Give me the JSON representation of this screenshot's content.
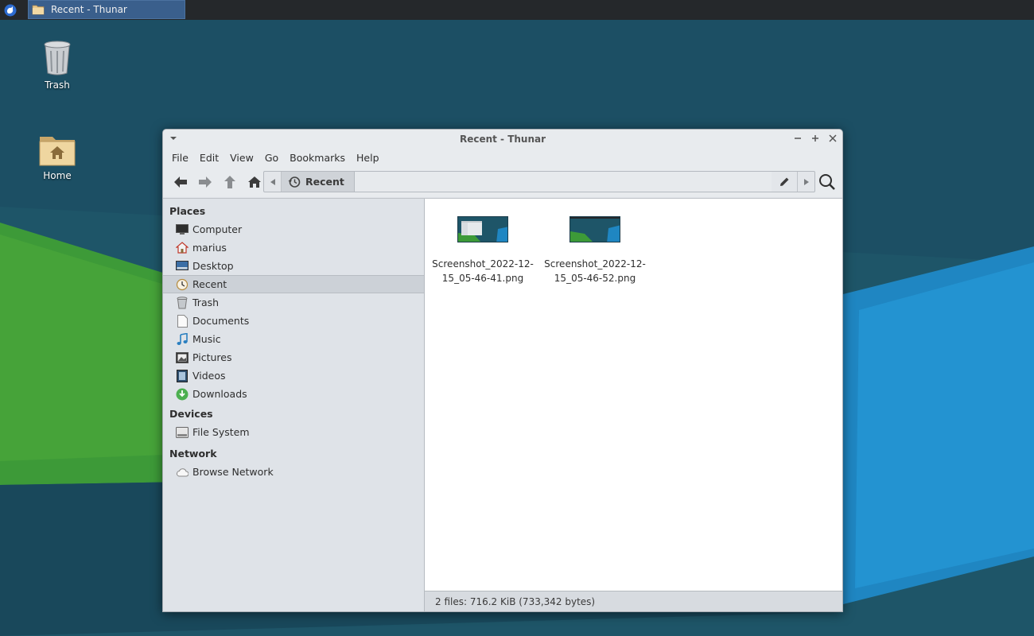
{
  "taskbar": {
    "window_button_label": "Recent - Thunar"
  },
  "desktop": {
    "icons": [
      {
        "label": "Trash"
      },
      {
        "label": "Home"
      }
    ]
  },
  "window": {
    "title": "Recent - Thunar",
    "menu": [
      "File",
      "Edit",
      "View",
      "Go",
      "Bookmarks",
      "Help"
    ],
    "path": {
      "current": "Recent"
    }
  },
  "sidebar": {
    "places_heading": "Places",
    "places": [
      {
        "label": "Computer",
        "icon": "computer-icon"
      },
      {
        "label": "marius",
        "icon": "home-icon"
      },
      {
        "label": "Desktop",
        "icon": "desktop-icon"
      },
      {
        "label": "Recent",
        "icon": "recent-icon",
        "active": true
      },
      {
        "label": "Trash",
        "icon": "trash-icon"
      },
      {
        "label": "Documents",
        "icon": "document-icon"
      },
      {
        "label": "Music",
        "icon": "music-icon"
      },
      {
        "label": "Pictures",
        "icon": "pictures-icon"
      },
      {
        "label": "Videos",
        "icon": "videos-icon"
      },
      {
        "label": "Downloads",
        "icon": "downloads-icon"
      }
    ],
    "devices_heading": "Devices",
    "devices": [
      {
        "label": "File System",
        "icon": "drive-icon"
      }
    ],
    "network_heading": "Network",
    "network": [
      {
        "label": "Browse Network",
        "icon": "network-icon"
      }
    ]
  },
  "files": [
    {
      "name": "Screenshot_2022-12-15_05-46-41.png"
    },
    {
      "name": "Screenshot_2022-12-15_05-46-52.png"
    }
  ],
  "status": {
    "text": "2 files: 716.2 KiB (733,342 bytes)"
  },
  "colors": {
    "panel": "#25282b",
    "taskbar_active": "#3a5f8c",
    "window_bg": "#dfe3e8",
    "sidebar_active": "#ccd1d7"
  }
}
